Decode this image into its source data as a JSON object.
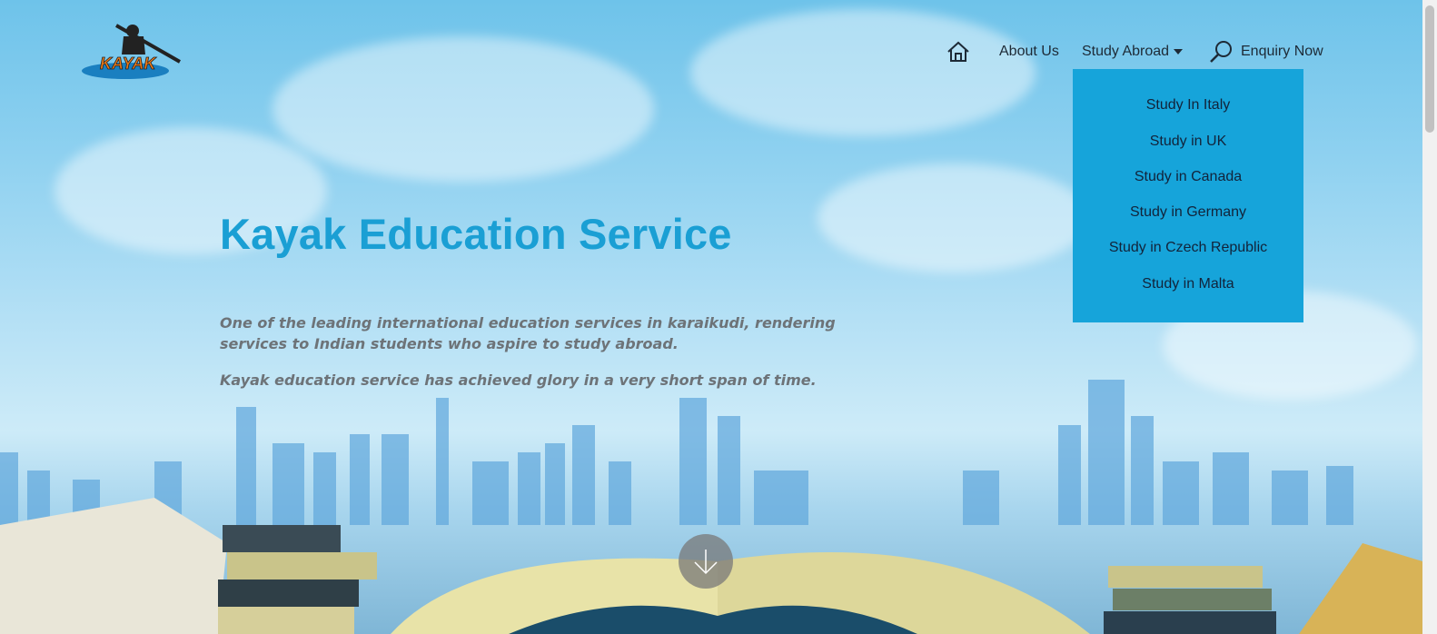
{
  "brand": {
    "logo_text": "KAYAK",
    "logo_colors": {
      "text": "#f07a17",
      "boat": "#1a7fc0",
      "figure": "#222222"
    }
  },
  "nav": {
    "home_icon": "home-icon",
    "about_label": "About Us",
    "study_label": "Study Abroad",
    "search_icon": "magnifier-icon",
    "enquiry_label": "Enquiry Now"
  },
  "dropdown": {
    "items": [
      {
        "label": "Study In Italy"
      },
      {
        "label": "Study in UK"
      },
      {
        "label": "Study in Canada"
      },
      {
        "label": "Study in Germany"
      },
      {
        "label": "Study in Czech Republic"
      },
      {
        "label": "Study in Malta"
      }
    ],
    "bg_color": "#16a4da"
  },
  "hero": {
    "title": "Kayak Education Service",
    "paragraph1": "One of the leading international education services in karaikudi, rendering services to Indian students who aspire to study abroad.",
    "paragraph2": "Kayak education service has achieved glory in a very short span of time.",
    "title_color": "#1a9fd4",
    "scroll_icon": "arrow-down-icon"
  }
}
